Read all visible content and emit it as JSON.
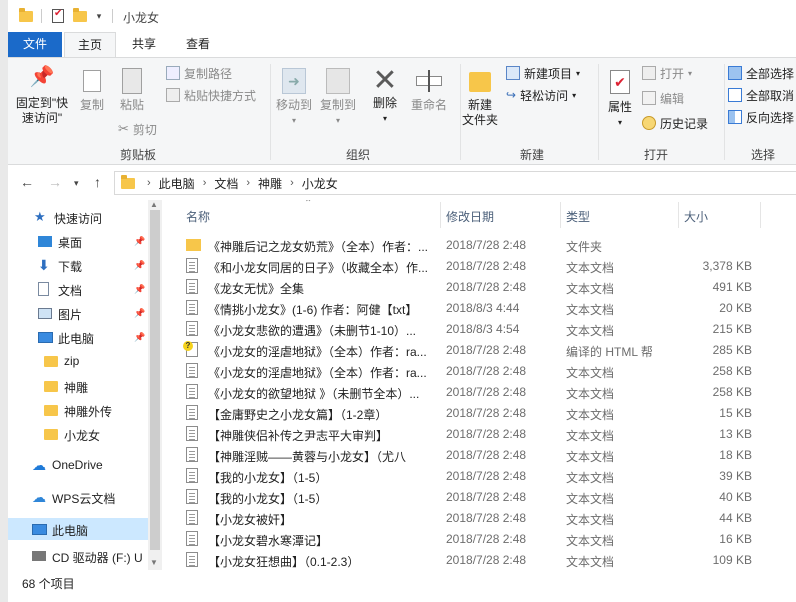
{
  "title": "小龙女",
  "ribbon_tabs": [
    "文件",
    "主页",
    "共享",
    "查看"
  ],
  "clipboard": {
    "pin": "固定到\"快\n速访问\"",
    "copy": "复制",
    "paste": "粘贴",
    "copy_path": "复制路径",
    "paste_shortcut": "粘贴快捷方式",
    "cut": "剪切",
    "label": "剪贴板"
  },
  "organize": {
    "move_to": "移动到",
    "copy_to": "复制到",
    "delete": "删除",
    "rename": "重命名",
    "label": "组织"
  },
  "new": {
    "new_folder": "新建\n文件夹",
    "new_item": "新建项目",
    "easy_access": "轻松访问",
    "label": "新建"
  },
  "open": {
    "properties": "属性",
    "open": "打开",
    "edit": "编辑",
    "history": "历史记录",
    "label": "打开"
  },
  "select": {
    "select_all": "全部选择",
    "select_none": "全部取消",
    "invert": "反向选择",
    "label": "选择"
  },
  "breadcrumb": [
    "此电脑",
    "文档",
    "神雕",
    "小龙女"
  ],
  "nav": [
    {
      "label": "快速访问",
      "icon": "star-icon",
      "pinned": false
    },
    {
      "label": "桌面",
      "icon": "desktop-icon",
      "pinned": true
    },
    {
      "label": "下载",
      "icon": "download-icon",
      "pinned": true
    },
    {
      "label": "文档",
      "icon": "document-icon",
      "pinned": true
    },
    {
      "label": "图片",
      "icon": "picture-icon",
      "pinned": true
    },
    {
      "label": "此电脑",
      "icon": "computer-icon",
      "pinned": true
    },
    {
      "label": "zip",
      "icon": "folder-icon",
      "pinned": false
    },
    {
      "label": "神雕",
      "icon": "folder-icon",
      "pinned": false
    },
    {
      "label": "神雕外传",
      "icon": "folder-icon",
      "pinned": false
    },
    {
      "label": "小龙女",
      "icon": "folder-icon",
      "pinned": false
    },
    {
      "label": "OneDrive",
      "icon": "cloud-icon",
      "pinned": false
    },
    {
      "label": "WPS云文档",
      "icon": "wps-cloud-icon",
      "pinned": false
    },
    {
      "label": "此电脑",
      "icon": "computer-icon",
      "pinned": false
    },
    {
      "label": "CD 驱动器 (F:) U",
      "icon": "cd-drive-icon",
      "pinned": false
    }
  ],
  "columns": {
    "name": "名称",
    "date": "修改日期",
    "type": "类型",
    "size": "大小"
  },
  "files": [
    {
      "name": "《神雕后记之龙女奶荒》（全本）作者：...",
      "date": "2018/7/28 2:48",
      "type": "文件夹",
      "size": "",
      "kind": "folder"
    },
    {
      "name": "《和小龙女同居的日子》（收藏全本）作...",
      "date": "2018/7/28 2:48",
      "type": "文本文档",
      "size": "3,378 KB",
      "kind": "txt"
    },
    {
      "name": "《龙女无忧》全集",
      "date": "2018/7/28 2:48",
      "type": "文本文档",
      "size": "491 KB",
      "kind": "txt"
    },
    {
      "name": "《情挑小龙女》(1-6) 作者：阿健【txt】",
      "date": "2018/8/3 4:44",
      "type": "文本文档",
      "size": "20 KB",
      "kind": "txt"
    },
    {
      "name": "《小龙女悲欲的遭遇》（未删节1-10）...",
      "date": "2018/8/3 4:54",
      "type": "文本文档",
      "size": "215 KB",
      "kind": "txt"
    },
    {
      "name": "《小龙女的淫虐地狱》（全本）作者：ra...",
      "date": "2018/7/28 2:48",
      "type": "编译的 HTML 帮",
      "size": "285 KB",
      "kind": "htm"
    },
    {
      "name": "《小龙女的淫虐地狱》（全本）作者：ra...",
      "date": "2018/7/28 2:48",
      "type": "文本文档",
      "size": "258 KB",
      "kind": "txt"
    },
    {
      "name": "《小龙女的欲望地狱 》（未删节全本）...",
      "date": "2018/7/28 2:48",
      "type": "文本文档",
      "size": "258 KB",
      "kind": "txt"
    },
    {
      "name": "【金庸野史之小龙女篇】（1-2章）",
      "date": "2018/7/28 2:48",
      "type": "文本文档",
      "size": "15 KB",
      "kind": "txt"
    },
    {
      "name": "【神雕侠侣补传之尹志平大审判】",
      "date": "2018/7/28 2:48",
      "type": "文本文档",
      "size": "13 KB",
      "kind": "txt"
    },
    {
      "name": "【神雕淫贼——黄蓉与小龙女】（尤八",
      "date": "2018/7/28 2:48",
      "type": "文本文档",
      "size": "18 KB",
      "kind": "txt"
    },
    {
      "name": "【我的小龙女】（1-5）",
      "date": "2018/7/28 2:48",
      "type": "文本文档",
      "size": "39 KB",
      "kind": "txt"
    },
    {
      "name": "【我的小龙女】（1-5）",
      "date": "2018/7/28 2:48",
      "type": "文本文档",
      "size": "40 KB",
      "kind": "txt"
    },
    {
      "name": "【小龙女被奸】",
      "date": "2018/7/28 2:48",
      "type": "文本文档",
      "size": "44 KB",
      "kind": "txt"
    },
    {
      "name": "【小龙女碧水寒潭记】",
      "date": "2018/7/28 2:48",
      "type": "文本文档",
      "size": "16 KB",
      "kind": "txt"
    },
    {
      "name": "【小龙女狂想曲】（0.1-2.3）",
      "date": "2018/7/28 2:48",
      "type": "文本文档",
      "size": "109 KB",
      "kind": "txt"
    }
  ],
  "status": {
    "item_count": "68 个项目"
  },
  "colors": {
    "accent": "#1b6ac9",
    "selected": "#cce8ff",
    "folder": "#f7c64a"
  }
}
